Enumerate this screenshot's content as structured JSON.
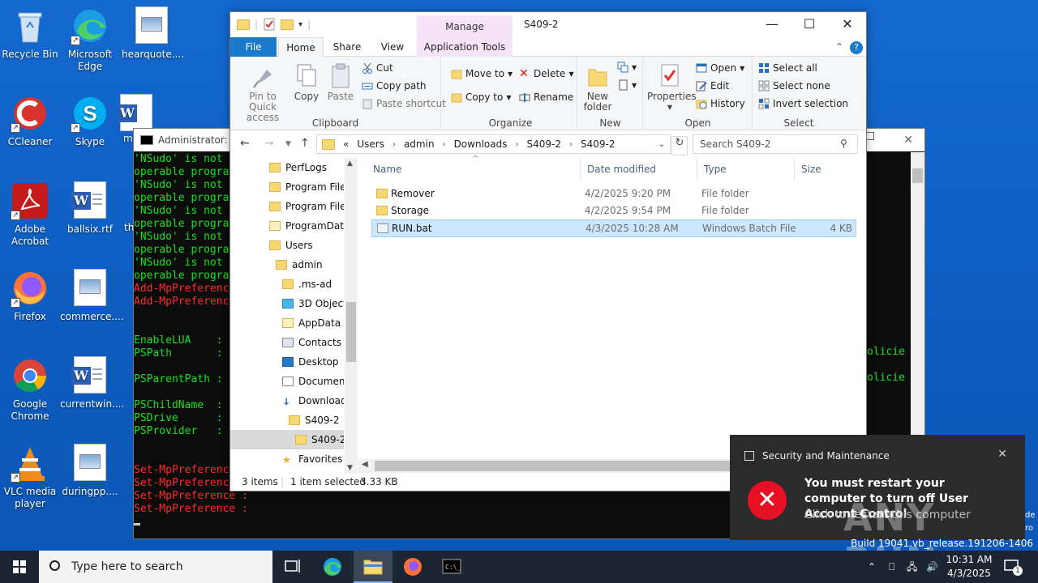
{
  "desktop": {
    "icons": [
      {
        "label": "Recycle Bin",
        "icon": "recycle-bin-icon"
      },
      {
        "label": "Microsoft Edge",
        "icon": "edge-icon"
      },
      {
        "label": "hearquote....",
        "icon": "image-file-icon"
      },
      {
        "label": "CCleaner",
        "icon": "ccleaner-icon"
      },
      {
        "label": "Skype",
        "icon": "skype-icon"
      },
      {
        "label": "m",
        "icon": "word-icon"
      },
      {
        "label": "Adobe Acrobat",
        "icon": "acrobat-icon"
      },
      {
        "label": "ballsix.rtf",
        "icon": "word-icon"
      },
      {
        "label": "th",
        "icon": "file-icon"
      },
      {
        "label": "Firefox",
        "icon": "firefox-icon"
      },
      {
        "label": "commerce....",
        "icon": "image-file-icon"
      },
      {
        "label": "Google Chrome",
        "icon": "chrome-icon"
      },
      {
        "label": "currentwin....",
        "icon": "word-icon"
      },
      {
        "label": "VLC media player",
        "icon": "vlc-icon"
      },
      {
        "label": "duringpp....",
        "icon": "image-file-icon"
      }
    ]
  },
  "cmd": {
    "title": "Administrator: Ir",
    "lines": [
      {
        "text": "'NSudo' is not",
        "color": "g"
      },
      {
        "text": "operable progra",
        "color": "g"
      },
      {
        "text": "'NSudo' is not",
        "color": "g"
      },
      {
        "text": "operable progra",
        "color": "g"
      },
      {
        "text": "'NSudo' is not",
        "color": "g"
      },
      {
        "text": "operable progra",
        "color": "g"
      },
      {
        "text": "'NSudo' is not",
        "color": "g"
      },
      {
        "text": "operable progra",
        "color": "g"
      },
      {
        "text": "'NSudo' is not",
        "color": "g"
      },
      {
        "text": "operable progra",
        "color": "g"
      },
      {
        "text": "Add-MpPreferenc",
        "color": "r"
      },
      {
        "text": "Add-MpPreferenc",
        "color": "r"
      },
      {
        "text": "",
        "color": "g"
      },
      {
        "text": "",
        "color": "g"
      },
      {
        "text": "EnableLUA    :",
        "color": "g"
      },
      {
        "text": "PSPath       :",
        "color": "g"
      },
      {
        "text": "",
        "color": "g"
      },
      {
        "text": "PSParentPath :",
        "color": "g"
      },
      {
        "text": "",
        "color": "g"
      },
      {
        "text": "PSChildName  :",
        "color": "g"
      },
      {
        "text": "PSDrive      :",
        "color": "g"
      },
      {
        "text": "PSProvider   :",
        "color": "g"
      },
      {
        "text": "",
        "color": "g"
      },
      {
        "text": "",
        "color": "g"
      },
      {
        "text": "Set-MpPreferenc",
        "color": "r"
      },
      {
        "text": "Set-MpPreference :",
        "color": "r"
      },
      {
        "text": "Set-MpPreference :",
        "color": "r"
      },
      {
        "text": "Set-MpPreference :",
        "color": "r"
      }
    ],
    "right_fragments": [
      "olicie",
      "olicie"
    ]
  },
  "explorer": {
    "title": "S409-2",
    "manage_tab": "Manage",
    "tabs": [
      "File",
      "Home",
      "Share",
      "View",
      "Application Tools"
    ],
    "ribbon": {
      "clipboard": {
        "label": "Clipboard",
        "pin": "Pin to Quick access",
        "copy": "Copy",
        "paste": "Paste",
        "cut": "Cut",
        "copy_path": "Copy path",
        "paste_shortcut": "Paste shortcut"
      },
      "organize": {
        "label": "Organize",
        "move_to": "Move to",
        "copy_to": "Copy to",
        "delete": "Delete",
        "rename": "Rename"
      },
      "new": {
        "label": "New",
        "new_folder": "New folder"
      },
      "open": {
        "label": "Open",
        "properties": "Properties",
        "open": "Open",
        "edit": "Edit",
        "history": "History"
      },
      "select": {
        "label": "Select",
        "select_all": "Select all",
        "select_none": "Select none",
        "invert": "Invert selection"
      }
    },
    "address": {
      "prefix": "«",
      "crumbs": [
        "Users",
        "admin",
        "Downloads",
        "S409-2",
        "S409-2"
      ]
    },
    "search_placeholder": "Search S409-2",
    "nav_items": [
      {
        "label": "PerfLogs",
        "indent": 0
      },
      {
        "label": "Program Files",
        "indent": 0
      },
      {
        "label": "Program Files",
        "indent": 0
      },
      {
        "label": "ProgramData",
        "indent": 0
      },
      {
        "label": "Users",
        "indent": 0
      },
      {
        "label": "admin",
        "indent": 1
      },
      {
        "label": ".ms-ad",
        "indent": 2
      },
      {
        "label": "3D Objects",
        "indent": 2
      },
      {
        "label": "AppData",
        "indent": 2
      },
      {
        "label": "Contacts",
        "indent": 2
      },
      {
        "label": "Desktop",
        "indent": 2
      },
      {
        "label": "Documents",
        "indent": 2
      },
      {
        "label": "Downloads",
        "indent": 2
      },
      {
        "label": "S409-2",
        "indent": 3
      },
      {
        "label": "S409-2",
        "indent": 4
      },
      {
        "label": "Favorites",
        "indent": 2
      }
    ],
    "columns": [
      "Name",
      "Date modified",
      "Type",
      "Size"
    ],
    "files": [
      {
        "name": "Remover",
        "date": "4/2/2025 9:20 PM",
        "type": "File folder",
        "size": "",
        "kind": "folder"
      },
      {
        "name": "Storage",
        "date": "4/2/2025 9:54 PM",
        "type": "File folder",
        "size": "",
        "kind": "folder"
      },
      {
        "name": "RUN.bat",
        "date": "4/3/2025 10:28 AM",
        "type": "Windows Batch File",
        "size": "4 KB",
        "kind": "bat"
      }
    ],
    "status": {
      "count": "3 items",
      "selected": "1 item selected",
      "size": "3.33 KB"
    }
  },
  "toast": {
    "app": "Security and Maintenance",
    "message": "You must restart your computer to turn off User Account Control",
    "sub": "Click to restart this computer"
  },
  "watermark": "ANY RUN",
  "build": "Build 19041.vb_release.191206-1406",
  "edge_texts": [
    "de",
    "ro"
  ],
  "taskbar": {
    "search_placeholder": "Type here to search",
    "time": "10:31 AM",
    "date": "4/3/2025",
    "notif_count": "1"
  },
  "colors": {
    "accent": "#1979ca",
    "cmd_green": "#13e21a",
    "cmd_red": "#ff2a2a",
    "error": "#e81123"
  }
}
